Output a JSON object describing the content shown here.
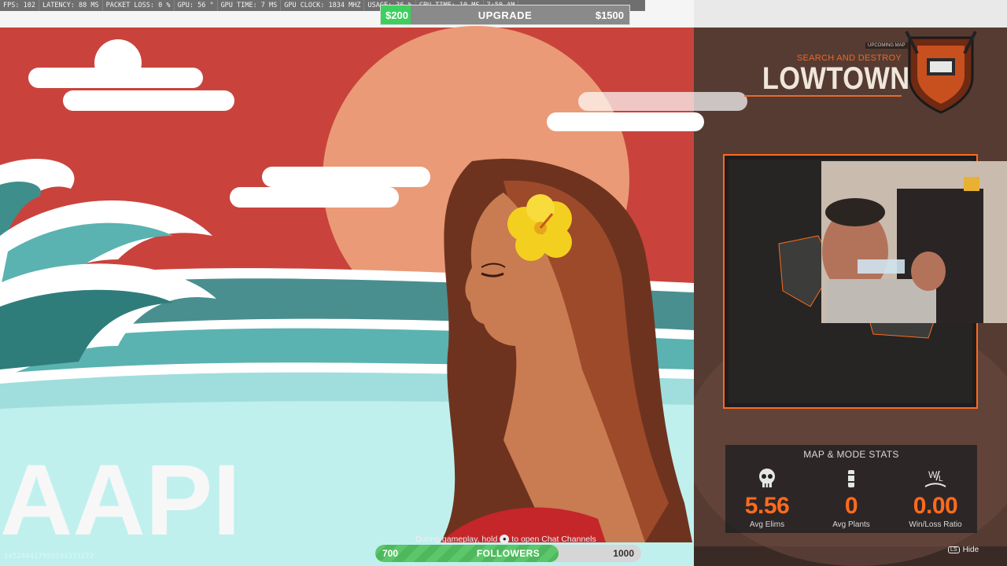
{
  "perf": {
    "fps": "FPS: 102",
    "latency": "LATENCY: 88 MS",
    "packet_loss": "PACKET LOSS: 0 %",
    "gpu": "GPU: 56 °",
    "gpu_time": "GPU TIME: 7 MS",
    "gpu_clock": "GPU CLOCK: 1834 MHZ",
    "cpu_usage": "USAGE: 36 %",
    "cpu_time": "CPU TIME: 10 MS",
    "clock": "7:50 AM"
  },
  "upgrade_bar": {
    "left_value": "$200",
    "label": "UPGRADE",
    "right_value": "$1500",
    "progress": 0.12
  },
  "match": {
    "tag": "UPCOMING MAP",
    "mode": "SEARCH AND DESTROY",
    "map": "LOWTOWN"
  },
  "stats": {
    "heading": "MAP & MODE STATS",
    "items": [
      {
        "icon": "skull-icon",
        "value": "5.56",
        "label": "Avg Elims"
      },
      {
        "icon": "bomb-icon",
        "value": "0",
        "label": "Avg Plants"
      },
      {
        "icon": "win-loss-icon",
        "value": "0.00",
        "label": "Win/Loss Ratio"
      }
    ]
  },
  "background_text": "AAPI",
  "hint": {
    "before": "During gameplay, hold",
    "after": "to open Chat Channels"
  },
  "followers": {
    "start": "700",
    "label": "FOLLOWERS",
    "goal": "1000",
    "progress": 0.69
  },
  "uid": "145244417955591333172",
  "hide": {
    "key": "LS",
    "label": "Hide"
  },
  "colors": {
    "accent": "#ff6a1c",
    "green": "#3ecf5e",
    "sky": "#c9433c"
  }
}
